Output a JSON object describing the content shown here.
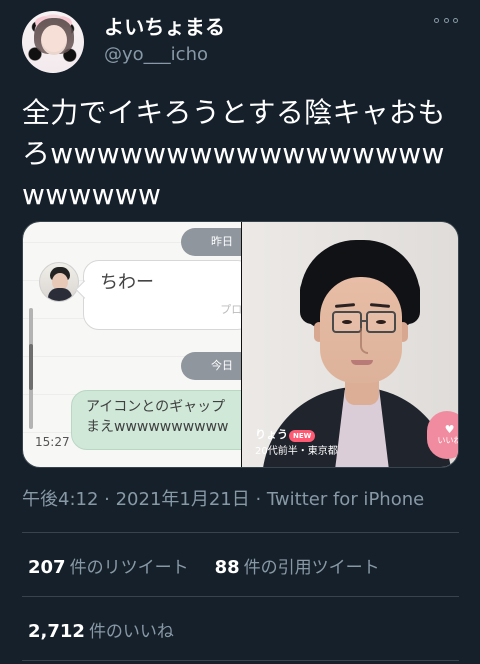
{
  "author": {
    "display_name": "よいちょまる",
    "handle": "@yo___icho"
  },
  "tweet": {
    "text": "全力でイキろうとする陰キャおもろwwwwwwwwwwwwwwwwwwwwwww"
  },
  "media": {
    "left": {
      "top_date": "昨日",
      "bubble_text": "ちわー",
      "bubble_note": "プロフィ",
      "second_date": "今日",
      "green_bubble_text": "アイコンとのギャップ\nまえwwwwwwwwww",
      "time": "15:27"
    },
    "right": {
      "name": "りょう",
      "badge": "NEW",
      "meta": "20代前半・東京都",
      "like_text": "いいね"
    }
  },
  "meta": {
    "line": "午後4:12 · 2021年1月21日 · Twitter for iPhone"
  },
  "stats": {
    "retweets_value": "207",
    "retweets_label": "件のリツイート",
    "quotes_value": "88",
    "quotes_label": "件の引用ツイート",
    "likes_value": "2,712",
    "likes_label": "件のいいね"
  },
  "colors": {
    "background": "#15202b",
    "muted": "#8899a6",
    "divider": "#38444d",
    "accent_pink": "#ff5a73"
  },
  "icons": {
    "more": "more-horizontal-icon",
    "heart": "heart-icon"
  }
}
